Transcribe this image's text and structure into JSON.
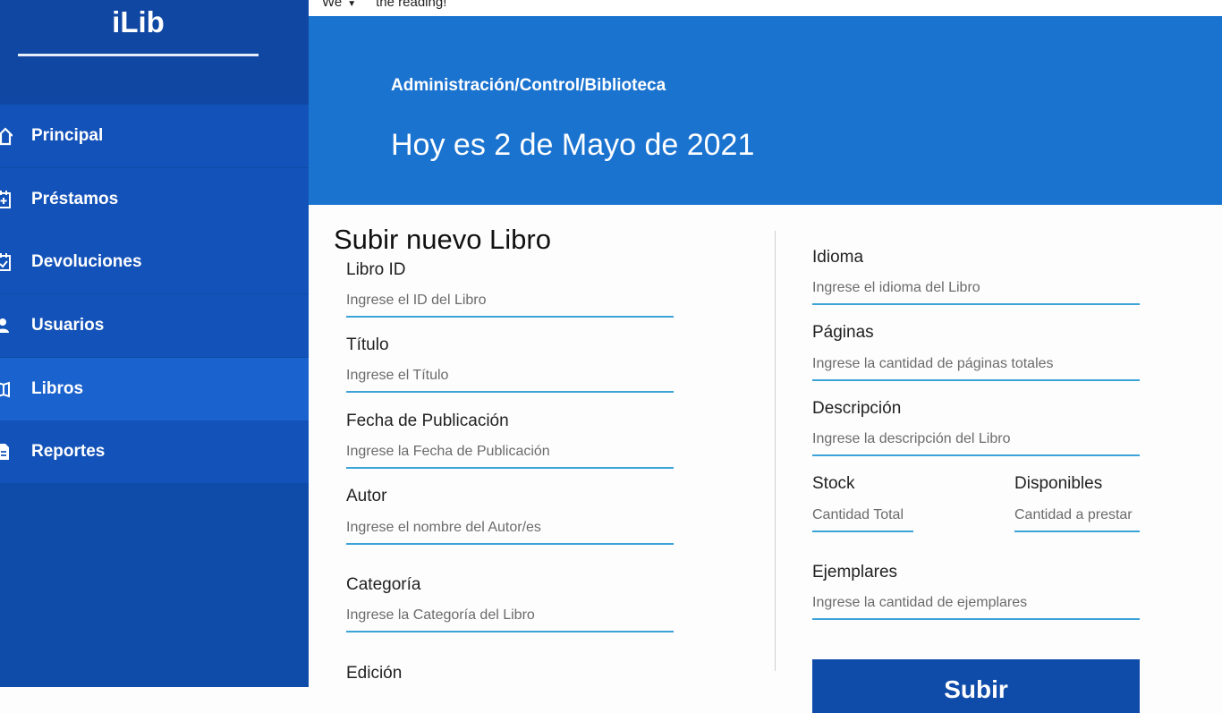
{
  "app": {
    "title": "iLib"
  },
  "topbar": {
    "left_text": "We",
    "right_text": "the reading!"
  },
  "sidebar": {
    "items": [
      {
        "label": "Principal",
        "icon": "home-icon"
      },
      {
        "label": "Préstamos",
        "icon": "calendar-add-icon"
      },
      {
        "label": "Devoluciones",
        "icon": "calendar-check-icon"
      },
      {
        "label": "Usuarios",
        "icon": "users-icon"
      },
      {
        "label": "Libros",
        "icon": "book-icon",
        "active": true
      },
      {
        "label": "Reportes",
        "icon": "report-icon"
      }
    ]
  },
  "header": {
    "breadcrumb": "Administración/Control/Biblioteca",
    "date": "Hoy es 2 de Mayo de 2021"
  },
  "form": {
    "title": "Subir nuevo Libro",
    "left_fields": [
      {
        "label": "Libro ID",
        "placeholder": "Ingrese el ID del Libro"
      },
      {
        "label": "Título",
        "placeholder": "Ingrese el Título"
      },
      {
        "label": "Fecha de Publicación",
        "placeholder": "Ingrese la Fecha de Publicación"
      },
      {
        "label": "Autor",
        "placeholder": "Ingrese el nombre del Autor/es"
      },
      {
        "label": "Categoría",
        "placeholder": "Ingrese la Categoría del Libro"
      },
      {
        "label": "Edición",
        "placeholder": ""
      }
    ],
    "right_fields": [
      {
        "label": "Idioma",
        "placeholder": "Ingrese el idioma del Libro"
      },
      {
        "label": "Páginas",
        "placeholder": "Ingrese la cantidad de páginas totales"
      },
      {
        "label": "Descripción",
        "placeholder": "Ingrese la descripción del Libro"
      },
      {
        "label": "Stock",
        "placeholder": "Cantidad Total"
      },
      {
        "label": "Disponibles",
        "placeholder": "Cantidad a prestar"
      },
      {
        "label": "Ejemplares",
        "placeholder": "Ingrese la cantidad de ejemplares"
      }
    ],
    "submit_label": "Subir"
  },
  "colors": {
    "sidebar": "#0f4ba8",
    "nav_item": "#1352b8",
    "nav_active": "#1a62cd",
    "banner": "#1b73d0",
    "input_underline": "#3ca3d8"
  }
}
